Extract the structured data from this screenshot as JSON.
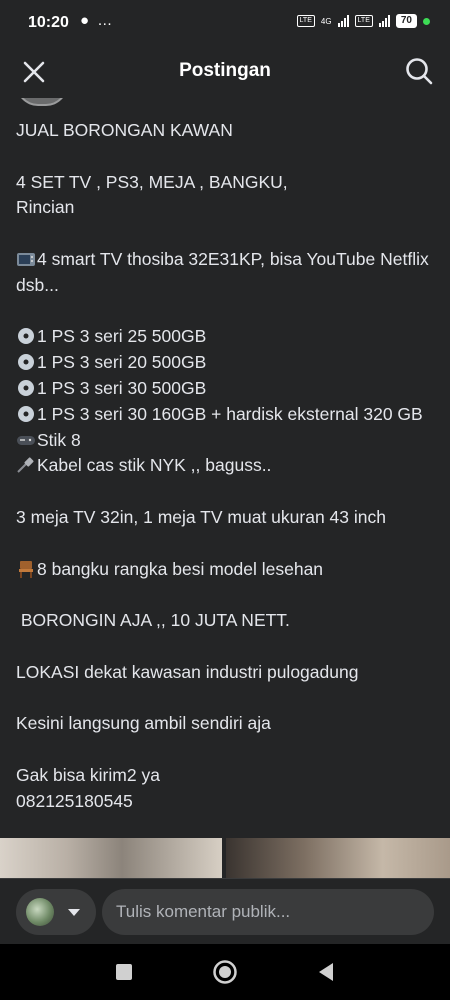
{
  "status": {
    "time": "10:20",
    "left_icons": "● …",
    "network": "4G",
    "lte_label": "VoLTE",
    "battery": "70"
  },
  "header": {
    "title": "Postingan",
    "close_icon": "close-icon",
    "search_icon": "search-icon"
  },
  "post": {
    "lines": [
      "JUAL BORONGAN KAWAN",
      "",
      "4 SET TV , PS3, MEJA , BANGKU,",
      "Rincian",
      "",
      "4 smart TV thosiba 32E31KP, bisa YouTube Netflix dsb...",
      "",
      "1 PS 3 seri 25 500GB",
      "1 PS 3 seri 20 500GB",
      "1 PS 3 seri 30 500GB",
      "1 PS 3 seri 30 160GB + hardisk eksternal 320 GB",
      "Stik 8",
      "Kabel cas stik NYK ,, baguss..",
      "",
      "3 meja TV 32in, 1 meja TV muat ukuran 43 inch",
      "",
      "8 bangku rangka besi model lesehan",
      "",
      " BORONGIN AJA ,, 10 JUTA NETT.",
      "",
      "LOKASI dekat kawasan industri pulogadung",
      "",
      "Kesini langsung ambil sendiri aja",
      "",
      "Gak bisa kirim2 ya",
      "082125180545"
    ]
  },
  "comment": {
    "placeholder": "Tulis komentar publik..."
  },
  "colors": {
    "background": "#242526",
    "text": "#e4e6eb",
    "input_bg": "#3a3b3c"
  }
}
